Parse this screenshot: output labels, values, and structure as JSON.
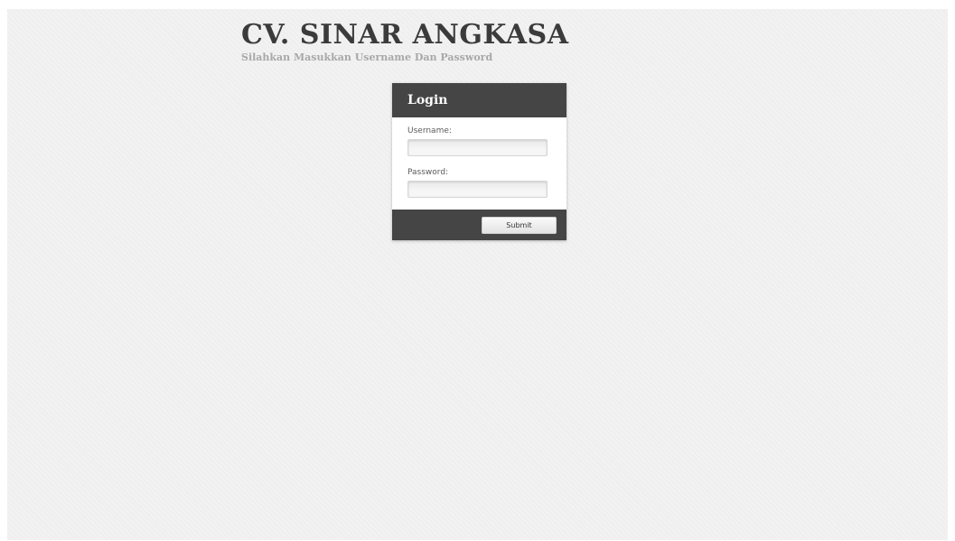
{
  "header": {
    "title": "CV. SINAR ANGKASA",
    "subtitle": "Silahkan Masukkan Username Dan Password"
  },
  "login": {
    "heading": "Login",
    "username_label": "Username:",
    "username_value": "",
    "password_label": "Password:",
    "password_value": "",
    "submit_label": "Submit"
  }
}
